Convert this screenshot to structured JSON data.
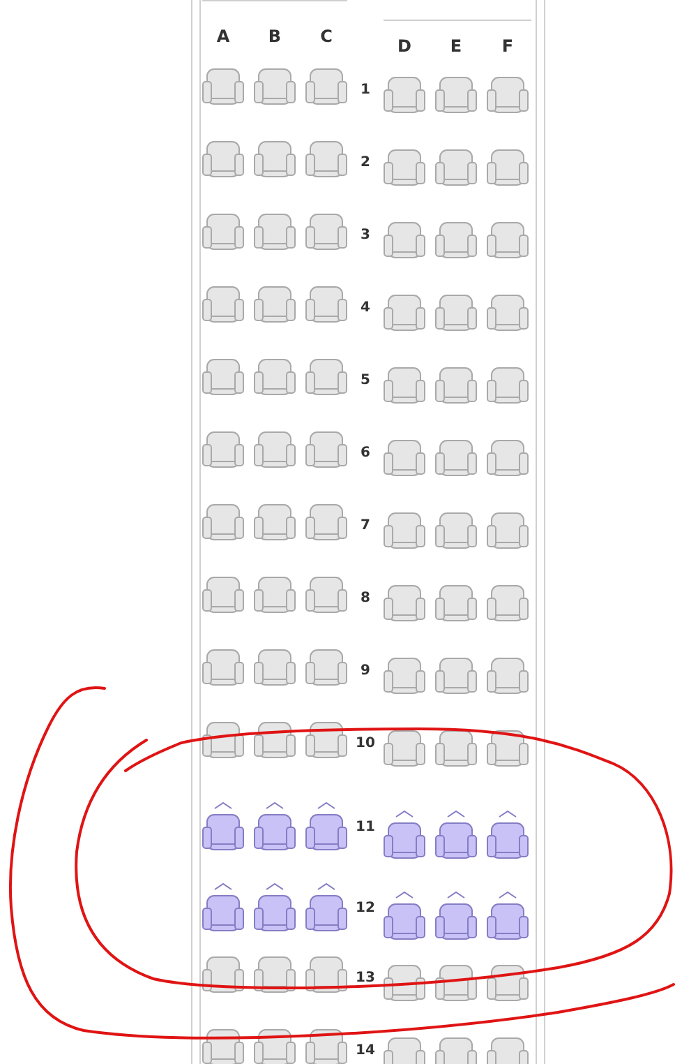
{
  "columns_left": [
    "A",
    "B",
    "C"
  ],
  "columns_right": [
    "D",
    "E",
    "F"
  ],
  "rows": [
    {
      "label": "1",
      "kind": "standard"
    },
    {
      "label": "2",
      "kind": "standard"
    },
    {
      "label": "3",
      "kind": "standard"
    },
    {
      "label": "4",
      "kind": "standard"
    },
    {
      "label": "5",
      "kind": "standard"
    },
    {
      "label": "6",
      "kind": "standard"
    },
    {
      "label": "7",
      "kind": "standard"
    },
    {
      "label": "8",
      "kind": "standard"
    },
    {
      "label": "9",
      "kind": "standard"
    },
    {
      "label": "10",
      "kind": "standard"
    },
    {
      "label": "11",
      "kind": "extra"
    },
    {
      "label": "12",
      "kind": "extra"
    },
    {
      "label": "13",
      "kind": "standard"
    },
    {
      "label": "14",
      "kind": "standard"
    }
  ]
}
